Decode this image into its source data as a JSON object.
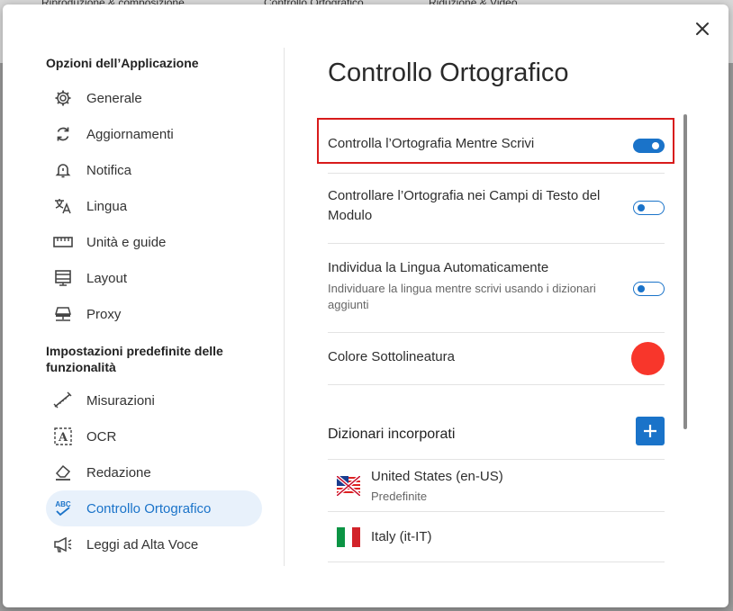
{
  "background_tabs": [
    "Riproduzione & composizione",
    "Controllo Ortografico",
    "Riduzione & Video"
  ],
  "sidebar": {
    "section1_title": "Opzioni dell’Applicazione",
    "items1": [
      {
        "label": "Generale",
        "icon": "gear-icon"
      },
      {
        "label": "Aggiornamenti",
        "icon": "refresh-icon"
      },
      {
        "label": "Notifica",
        "icon": "bell-icon"
      },
      {
        "label": "Lingua",
        "icon": "translate-icon"
      },
      {
        "label": "Unità e guide",
        "icon": "ruler-icon"
      },
      {
        "label": "Layout",
        "icon": "layout-icon"
      },
      {
        "label": "Proxy",
        "icon": "proxy-icon"
      }
    ],
    "section2_title": "Impostazioni predefinite delle funzionalità",
    "items2": [
      {
        "label": "Misurazioni",
        "icon": "measure-icon"
      },
      {
        "label": "OCR",
        "icon": "ocr-icon"
      },
      {
        "label": "Redazione",
        "icon": "eraser-icon"
      },
      {
        "label": "Controllo Ortografico",
        "icon": "spellcheck-icon",
        "active": true
      },
      {
        "label": "Leggi ad Alta Voce",
        "icon": "megaphone-icon"
      }
    ]
  },
  "main": {
    "title": "Controllo Ortografico",
    "settings": [
      {
        "label": "Controlla l’Ortografia Mentre Scrivi",
        "toggle": "on"
      },
      {
        "label": "Controllare l’Ortografia nei Campi di Testo del Modulo",
        "toggle": "off"
      },
      {
        "label": "Individua la Lingua Automaticamente",
        "description": "Individuare la lingua mentre scrivi usando i dizionari aggiunti",
        "toggle": "off"
      },
      {
        "label": "Colore Sottolineatura",
        "color": "#f8362b"
      }
    ],
    "dictionaries_title": "Dizionari incorporati",
    "dictionaries": [
      {
        "name": "United States (en-US)",
        "sub": "Predefinite",
        "flag": "us-uk-flag"
      },
      {
        "name": "Italy (it-IT)",
        "sub": "",
        "flag": "italy-flag"
      }
    ]
  },
  "colors": {
    "accent": "#1a73c9",
    "highlight": "#d81b1b",
    "underline": "#f8362b"
  }
}
